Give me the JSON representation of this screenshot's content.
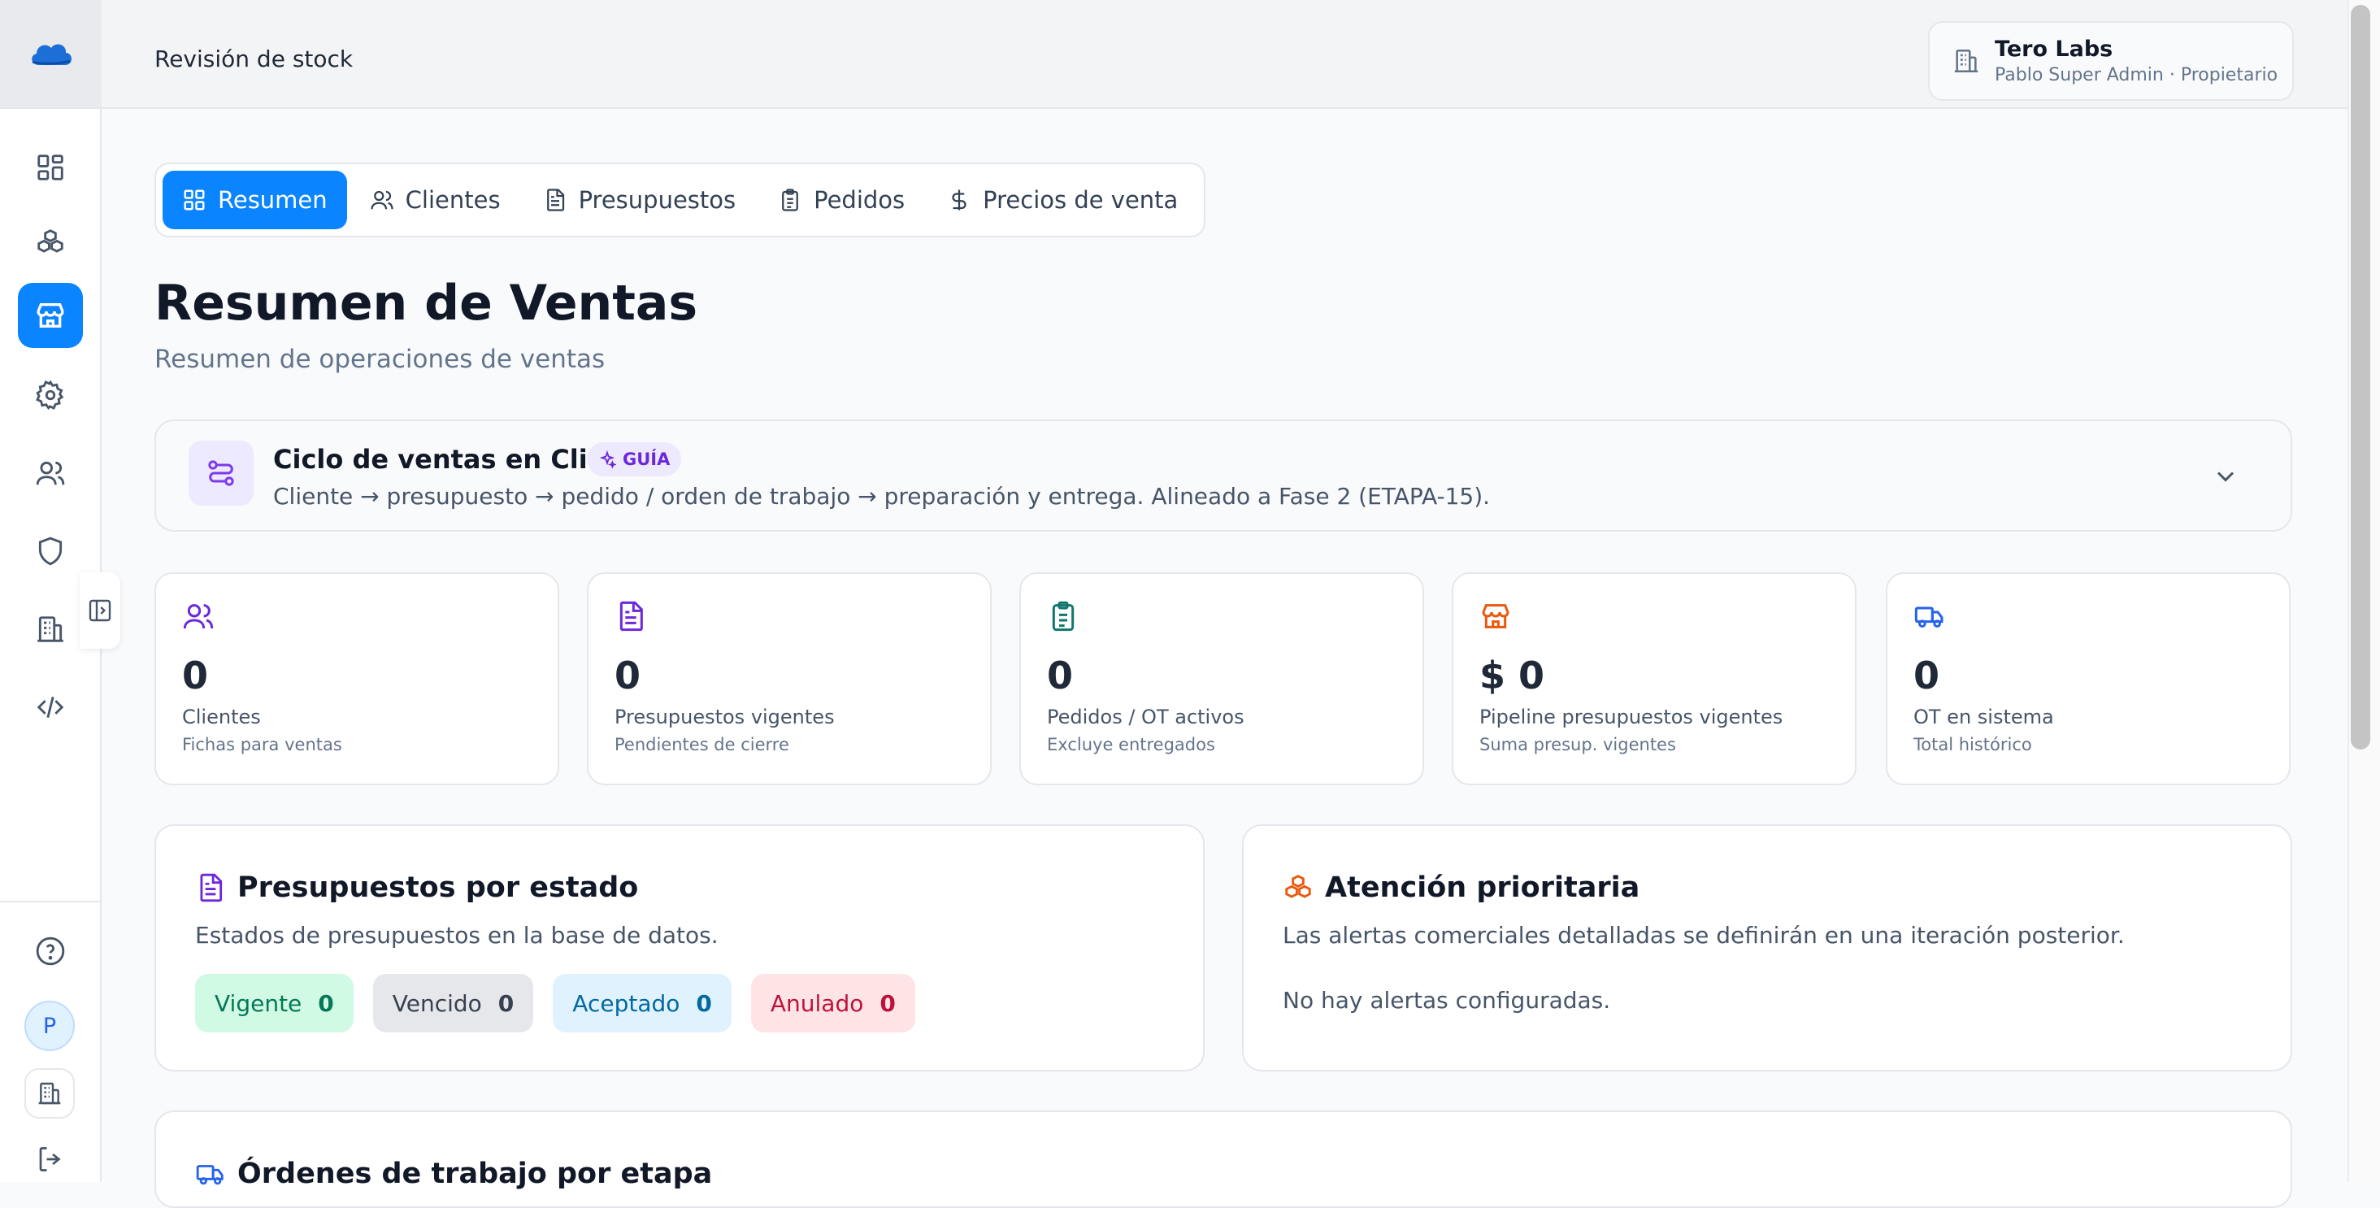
{
  "header": {
    "breadcrumb": "Revisión de stock",
    "org": {
      "name": "Tero Labs",
      "user": "Pablo Super Admin · Propietario"
    }
  },
  "sidebar": {
    "items": [
      {
        "icon": "dashboard-icon"
      },
      {
        "icon": "boxes-icon"
      },
      {
        "icon": "store-icon",
        "active": true
      },
      {
        "icon": "gear-icon"
      },
      {
        "icon": "users-icon"
      },
      {
        "icon": "shield-icon"
      },
      {
        "icon": "building-icon"
      },
      {
        "icon": "code-icon"
      }
    ],
    "bottom": {
      "help_icon": "help-circle-icon",
      "avatar_letter": "P",
      "org_icon": "building-icon",
      "logout_icon": "logout-icon"
    }
  },
  "tabs": [
    {
      "label": "Resumen",
      "icon": "grid-icon",
      "active": true
    },
    {
      "label": "Clientes",
      "icon": "users-icon"
    },
    {
      "label": "Presupuestos",
      "icon": "document-icon"
    },
    {
      "label": "Pedidos",
      "icon": "clipboard-icon"
    },
    {
      "label": "Precios de venta",
      "icon": "dollar-icon"
    }
  ],
  "page": {
    "title": "Resumen de Ventas",
    "subtitle": "Resumen de operaciones de ventas"
  },
  "guide": {
    "title": "Ciclo de ventas en Clink",
    "badge": "GUÍA",
    "text": "Cliente → presupuesto → pedido / orden de trabajo → preparación y entrega. Alineado a Fase 2 (ETAPA-15)."
  },
  "stats": [
    {
      "value": "0",
      "label": "Clientes",
      "sub": "Fichas para ventas",
      "icon": "users-icon",
      "color": "#6d28d9"
    },
    {
      "value": "0",
      "label": "Presupuestos vigentes",
      "sub": "Pendientes de cierre",
      "icon": "document-icon",
      "color": "#6d28d9"
    },
    {
      "value": "0",
      "label": "Pedidos / OT activos",
      "sub": "Excluye entregados",
      "icon": "clipboard-icon",
      "color": "#0f766e"
    },
    {
      "value": "$ 0",
      "label": "Pipeline presupuestos vigentes",
      "sub": "Suma presup. vigentes",
      "icon": "store-icon",
      "color": "#ea580c"
    },
    {
      "value": "0",
      "label": "OT en sistema",
      "sub": "Total histórico",
      "icon": "truck-icon",
      "color": "#2563eb"
    }
  ],
  "status_panel": {
    "title": "Presupuestos por estado",
    "desc": "Estados de presupuestos en la base de datos.",
    "statuses": [
      {
        "label": "Vigente",
        "count": "0",
        "bg": "#d1fae5",
        "fg": "#047857"
      },
      {
        "label": "Vencido",
        "count": "0",
        "bg": "#e5e7eb",
        "fg": "#374151"
      },
      {
        "label": "Aceptado",
        "count": "0",
        "bg": "#e0f2fe",
        "fg": "#0369a1"
      },
      {
        "label": "Anulado",
        "count": "0",
        "bg": "#ffe4e6",
        "fg": "#be123c"
      }
    ]
  },
  "attention_panel": {
    "title": "Atención prioritaria",
    "desc": "Las alertas comerciales detalladas se definirán en una iteración posterior.",
    "note": "No hay alertas configuradas."
  },
  "orders_panel": {
    "title": "Órdenes de trabajo por etapa"
  },
  "colors": {
    "accent": "#0b84ff"
  }
}
